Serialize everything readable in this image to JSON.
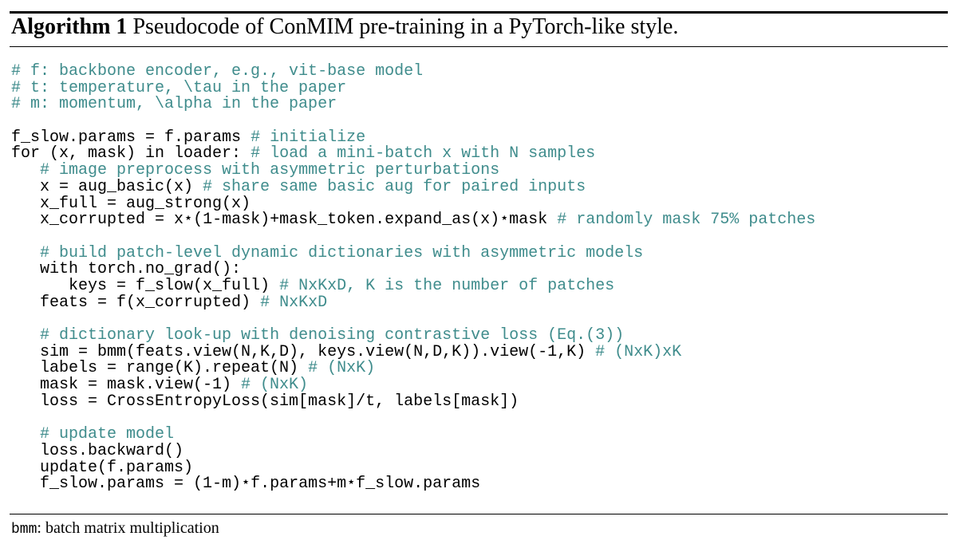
{
  "algorithm": {
    "label": "Algorithm 1",
    "caption": "Pseudocode of ConMIM pre-training in a PyTorch-like style."
  },
  "code_lines": [
    {
      "code": "",
      "comment": "# f: backbone encoder, e.g., vit-base model"
    },
    {
      "code": "",
      "comment": "# t: temperature, \\tau in the paper"
    },
    {
      "code": "",
      "comment": "# m: momentum, \\alpha in the paper"
    },
    {
      "code": "",
      "comment": ""
    },
    {
      "code": "f_slow.params = f.params ",
      "comment": "# initialize"
    },
    {
      "code": "for (x, mask) in loader: ",
      "comment": "# load a mini-batch x with N samples"
    },
    {
      "code": "   ",
      "comment": "# image preprocess with asymmetric perturbations"
    },
    {
      "code": "   x = aug_basic(x) ",
      "comment": "# share same basic aug for paired inputs"
    },
    {
      "code": "   x_full = aug_strong(x)",
      "comment": ""
    },
    {
      "code": "   x_corrupted = x⋆(1-mask)+mask_token.expand_as(x)⋆mask ",
      "comment": "# randomly mask 75% patches"
    },
    {
      "code": "",
      "comment": ""
    },
    {
      "code": "   ",
      "comment": "# build patch-level dynamic dictionaries with asymmetric models"
    },
    {
      "code": "   with torch.no_grad():",
      "comment": ""
    },
    {
      "code": "      keys = f_slow(x_full) ",
      "comment": "# NxKxD, K is the number of patches"
    },
    {
      "code": "   feats = f(x_corrupted) ",
      "comment": "# NxKxD"
    },
    {
      "code": "",
      "comment": ""
    },
    {
      "code": "   ",
      "comment": "# dictionary look-up with denoising contrastive loss (Eq.(3))"
    },
    {
      "code": "   sim = bmm(feats.view(N,K,D), keys.view(N,D,K)).view(-1,K) ",
      "comment": "# (NxK)xK"
    },
    {
      "code": "   labels = range(K).repeat(N) ",
      "comment": "# (NxK)"
    },
    {
      "code": "   mask = mask.view(-1) ",
      "comment": "# (NxK)"
    },
    {
      "code": "   loss = CrossEntropyLoss(sim[mask]/t, labels[mask])",
      "comment": ""
    },
    {
      "code": "",
      "comment": ""
    },
    {
      "code": "   ",
      "comment": "# update model"
    },
    {
      "code": "   loss.backward()",
      "comment": ""
    },
    {
      "code": "   update(f.params)",
      "comment": ""
    },
    {
      "code": "   f_slow.params = (1-m)⋆f.params+m⋆f_slow.params",
      "comment": ""
    }
  ],
  "footnote": {
    "term": "bmm",
    "text": ": batch matrix multiplication"
  },
  "colors": {
    "comment": "#3f8c8c",
    "text": "#000000"
  }
}
